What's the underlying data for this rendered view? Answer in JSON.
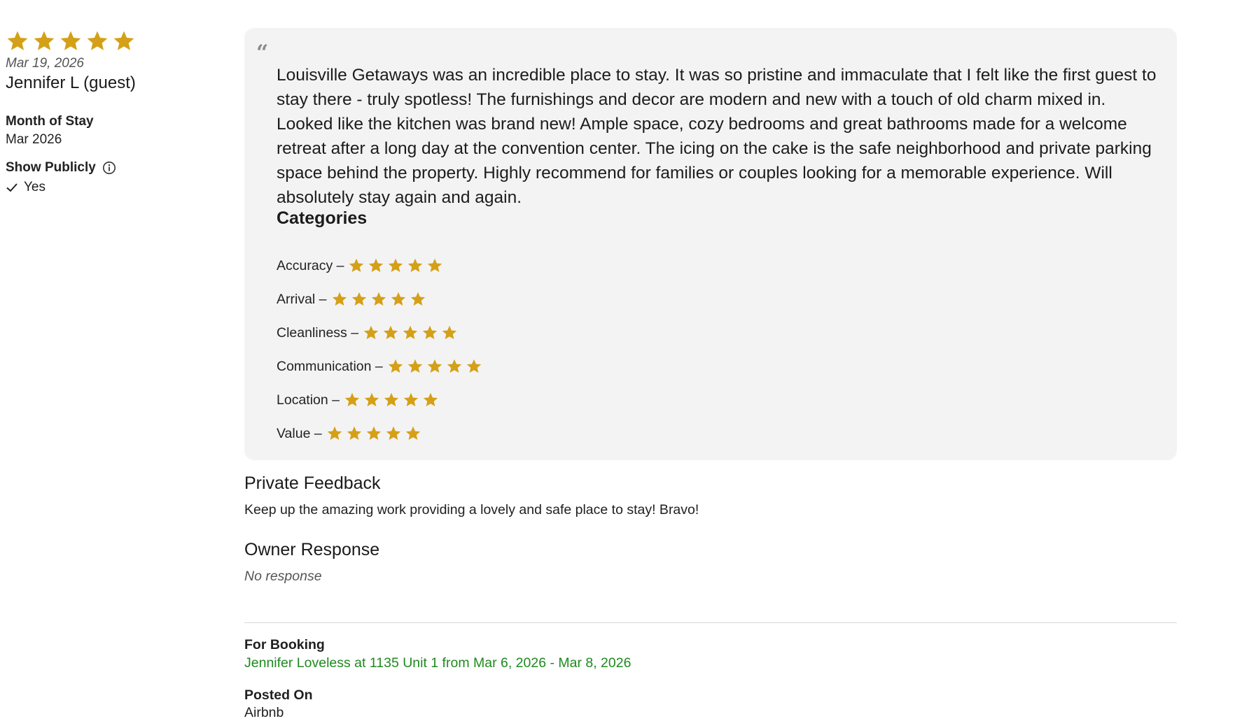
{
  "review": {
    "overall_rating": 5,
    "rating_max": 5,
    "date": "Mar 19, 2026",
    "guest_name": "Jennifer L (guest)",
    "month_of_stay_label": "Month of Stay",
    "month_of_stay_value": "Mar 2026",
    "show_publicly_label": "Show Publicly",
    "show_publicly_value": "Yes",
    "text": "Louisville Getaways was an incredible place to stay. It was so pristine and immaculate that I felt like the first guest to stay there - truly spotless!  The furnishings and decor are modern and new with a touch of old charm mixed in.  Looked like the kitchen was brand new!  Ample space, cozy bedrooms and great bathrooms made for a welcome retreat after a long day at the convention center.  The icing on the cake is the safe neighborhood and private parking space behind the property. Highly recommend for families or couples looking for a memorable experience. Will absolutely stay again and again."
  },
  "categories": {
    "title": "Categories",
    "items": [
      {
        "label": "Accuracy –",
        "rating": 5
      },
      {
        "label": "Arrival –",
        "rating": 5
      },
      {
        "label": "Cleanliness –",
        "rating": 5
      },
      {
        "label": "Communication –",
        "rating": 5
      },
      {
        "label": "Location –",
        "rating": 5
      },
      {
        "label": "Value –",
        "rating": 5
      }
    ]
  },
  "private_feedback": {
    "title": "Private Feedback",
    "text": "Keep up the amazing work providing a lovely and safe place to stay!  Bravo!"
  },
  "owner_response": {
    "title": "Owner Response",
    "text": "No response"
  },
  "booking": {
    "label": "For Booking",
    "link_text": "Jennifer Loveless at 1135 Unit 1 from Mar 6, 2026 - Mar 8, 2026"
  },
  "posted_on": {
    "label": "Posted On",
    "value": "Airbnb"
  },
  "colors": {
    "star": "#d4a017",
    "card_bg": "#f4f3f4",
    "link": "#1e8a1e"
  },
  "icons": {
    "star": "star-icon",
    "info": "info-icon",
    "check": "check-icon",
    "quote": "quote-icon"
  }
}
